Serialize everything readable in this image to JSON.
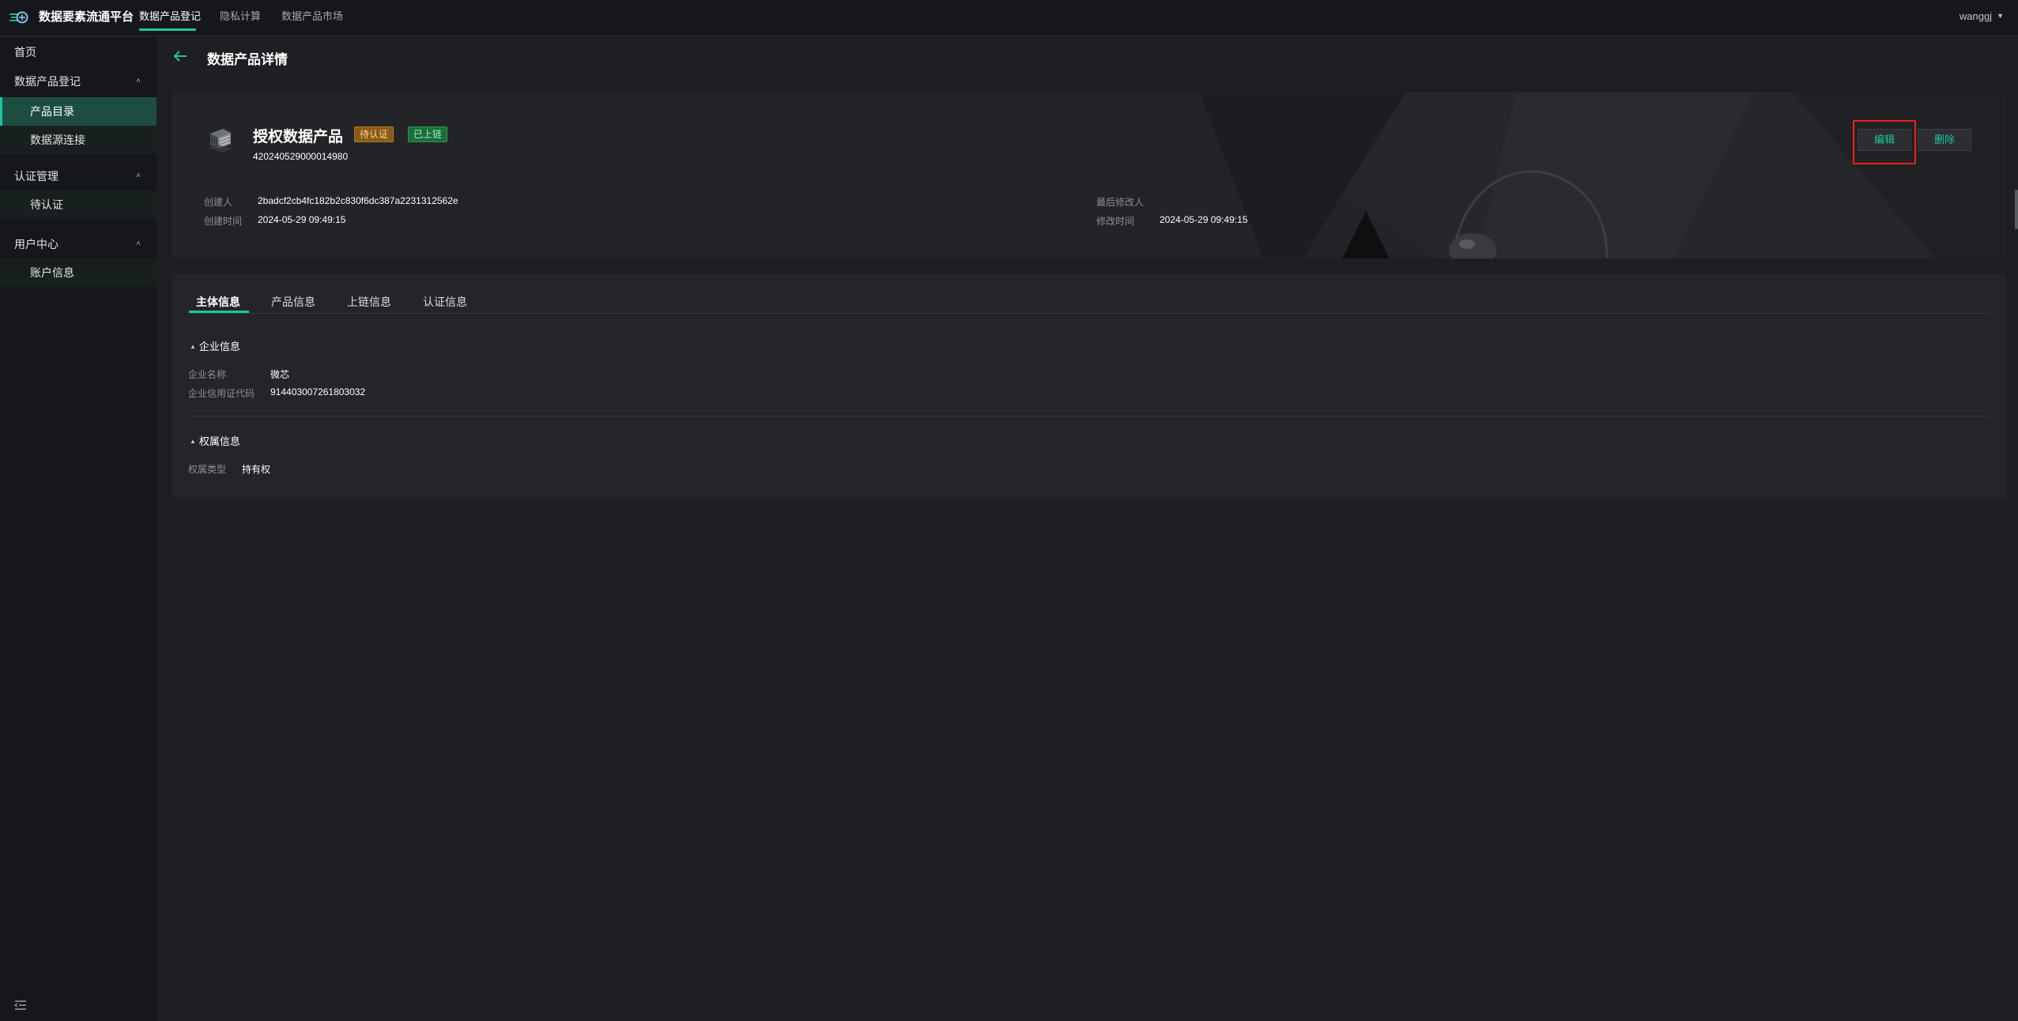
{
  "app": {
    "title": "数据要素流通平台",
    "user": "wanggj",
    "accent": "#1ec59c"
  },
  "topnav": {
    "items": [
      {
        "label": "数据产品登记",
        "active": true
      },
      {
        "label": "隐私计算",
        "active": false
      },
      {
        "label": "数据产品市场",
        "active": false
      }
    ]
  },
  "sidebar": {
    "home": "首页",
    "groups": [
      {
        "label": "数据产品登记",
        "items": [
          "产品目录",
          "数据源连接"
        ]
      },
      {
        "label": "认证管理",
        "items": [
          "待认证"
        ]
      },
      {
        "label": "用户中心",
        "items": [
          "账户信息"
        ]
      }
    ],
    "active_item": "产品目录"
  },
  "page": {
    "title": "数据产品详情"
  },
  "product": {
    "name": "授权数据产品",
    "badge_pending": "待认证",
    "badge_chain": "已上链",
    "id": "420240529000014980",
    "creator_label": "创建人",
    "creator": "2badcf2cb4fc182b2c830f6dc387a2231312562e",
    "created_label": "创建时间",
    "created": "2024-05-29 09:49:15",
    "modifier_label": "最后修改人",
    "modifier": "",
    "modified_label": "修改时间",
    "modified": "2024-05-29 09:49:15"
  },
  "actions": {
    "edit": "编辑",
    "delete": "删除"
  },
  "tabs": [
    {
      "label": "主体信息",
      "active": true
    },
    {
      "label": "产品信息",
      "active": false
    },
    {
      "label": "上链信息",
      "active": false
    },
    {
      "label": "认证信息",
      "active": false
    }
  ],
  "enterprise": {
    "section": "企业信息",
    "name_label": "企业名称",
    "name": "微芯",
    "credit_label": "企业信用证代码",
    "credit": "914403007261803032"
  },
  "ownership": {
    "section": "权属信息",
    "type_label": "权属类型",
    "type": "持有权"
  }
}
